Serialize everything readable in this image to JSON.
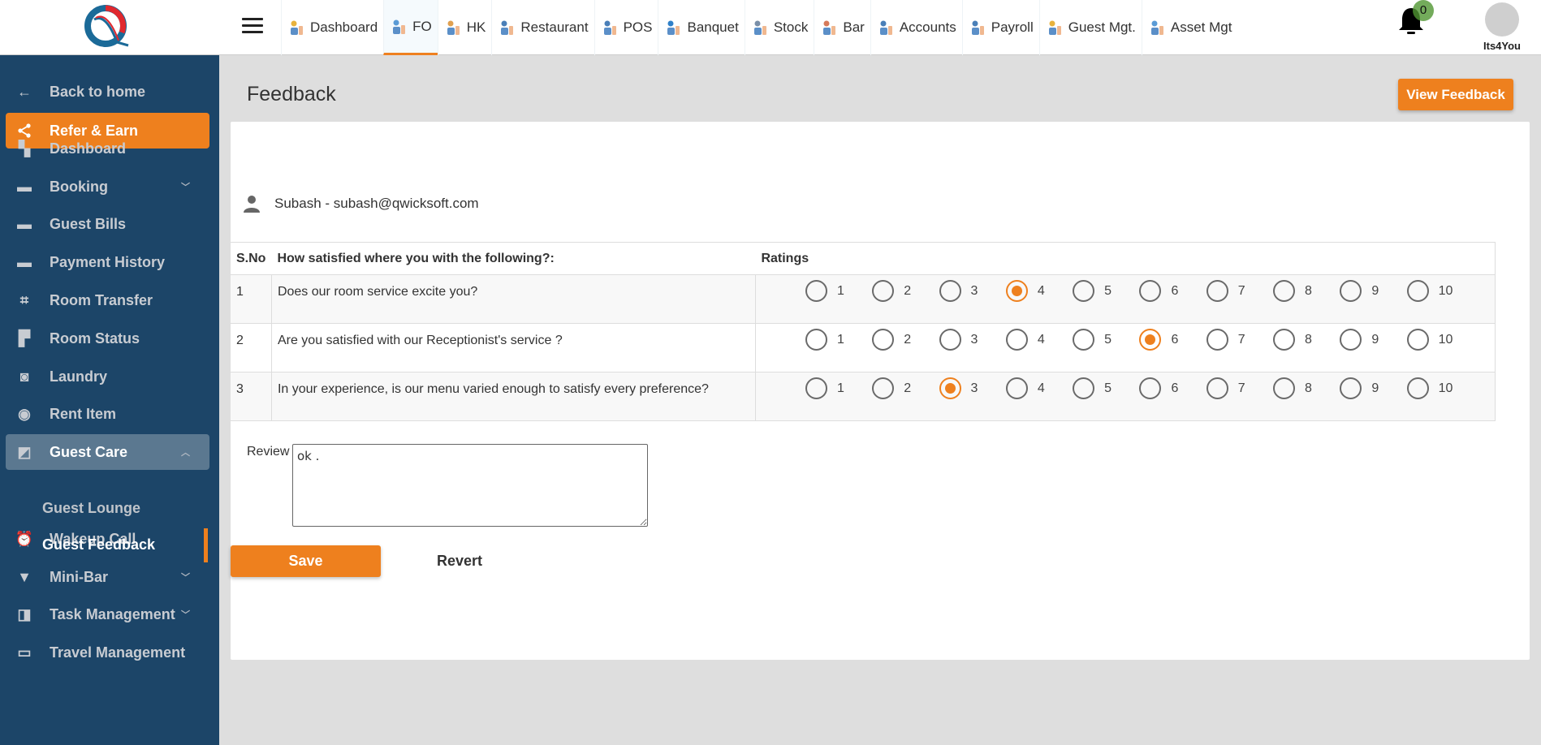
{
  "header": {
    "nav": [
      {
        "label": "Dashboard",
        "icon": "dashboard-grid-icon",
        "active": false
      },
      {
        "label": "FO",
        "icon": "front-office-icon",
        "active": true
      },
      {
        "label": "HK",
        "icon": "housekeeping-icon",
        "active": false
      },
      {
        "label": "Restaurant",
        "icon": "chef-icon",
        "active": false
      },
      {
        "label": "POS",
        "icon": "pos-chef-icon",
        "active": false
      },
      {
        "label": "Banquet",
        "icon": "banquet-icon",
        "active": false
      },
      {
        "label": "Stock",
        "icon": "warehouse-icon",
        "active": false
      },
      {
        "label": "Bar",
        "icon": "bar-icon",
        "active": false
      },
      {
        "label": "Accounts",
        "icon": "accounts-icon",
        "active": false
      },
      {
        "label": "Payroll",
        "icon": "payroll-icon",
        "active": false
      },
      {
        "label": "Guest Mgt.",
        "icon": "guest-mgt-icon",
        "active": false
      },
      {
        "label": "Asset Mgt",
        "icon": "asset-icon",
        "active": false
      }
    ],
    "notification_count": "0",
    "user_name": "Its4You"
  },
  "sidebar": {
    "back_label": "Back to home",
    "refer_label": "Refer & Earn",
    "items": [
      {
        "label": "Dashboard",
        "icon": "dashboard-icon"
      },
      {
        "label": "Booking",
        "icon": "bed-icon",
        "expandable": true
      },
      {
        "label": "Guest Bills",
        "icon": "bill-icon"
      },
      {
        "label": "Payment History",
        "icon": "payment-icon"
      },
      {
        "label": "Room Transfer",
        "icon": "crop-icon"
      },
      {
        "label": "Room Status",
        "icon": "paint-roller-icon"
      },
      {
        "label": "Laundry",
        "icon": "washing-machine-icon"
      },
      {
        "label": "Rent Item",
        "icon": "camera-icon"
      },
      {
        "label": "Guest Care",
        "icon": "cards-icon",
        "expandable": true,
        "open": true
      },
      {
        "label": "Wakeup Call",
        "icon": "alarm-icon"
      },
      {
        "label": "Mini-Bar",
        "icon": "glass-icon",
        "expandable": true
      },
      {
        "label": "Task Management",
        "icon": "library-icon",
        "expandable": true
      },
      {
        "label": "Travel Management",
        "icon": "taxi-icon"
      }
    ],
    "guest_care_sub": [
      {
        "label": "Guest Lounge",
        "active": false
      },
      {
        "label": "Guest Feedback",
        "active": true
      }
    ]
  },
  "page": {
    "title": "Feedback",
    "view_feedback_label": "View Feedback",
    "guest": "Subash - subash@qwicksoft.com",
    "table": {
      "headers": [
        "S.No",
        "How satisfied where you with the following?:",
        "Ratings"
      ],
      "scale": [
        "1",
        "2",
        "3",
        "4",
        "5",
        "6",
        "7",
        "8",
        "9",
        "10"
      ],
      "rows": [
        {
          "sno": "1",
          "question": "Does our room service excite you?",
          "rating": 4
        },
        {
          "sno": "2",
          "question": "Are you satisfied with our Receptionist's service ?",
          "rating": 6
        },
        {
          "sno": "3",
          "question": "In your experience, is our menu varied enough to satisfy every preference?",
          "rating": 3
        }
      ]
    },
    "review_label": "Review",
    "review_value": "ok .",
    "save_label": "Save",
    "revert_label": "Revert"
  },
  "colors": {
    "accent": "#ee801e",
    "sidebar": "#1c4568",
    "sidebar_open": "#5b7890"
  }
}
